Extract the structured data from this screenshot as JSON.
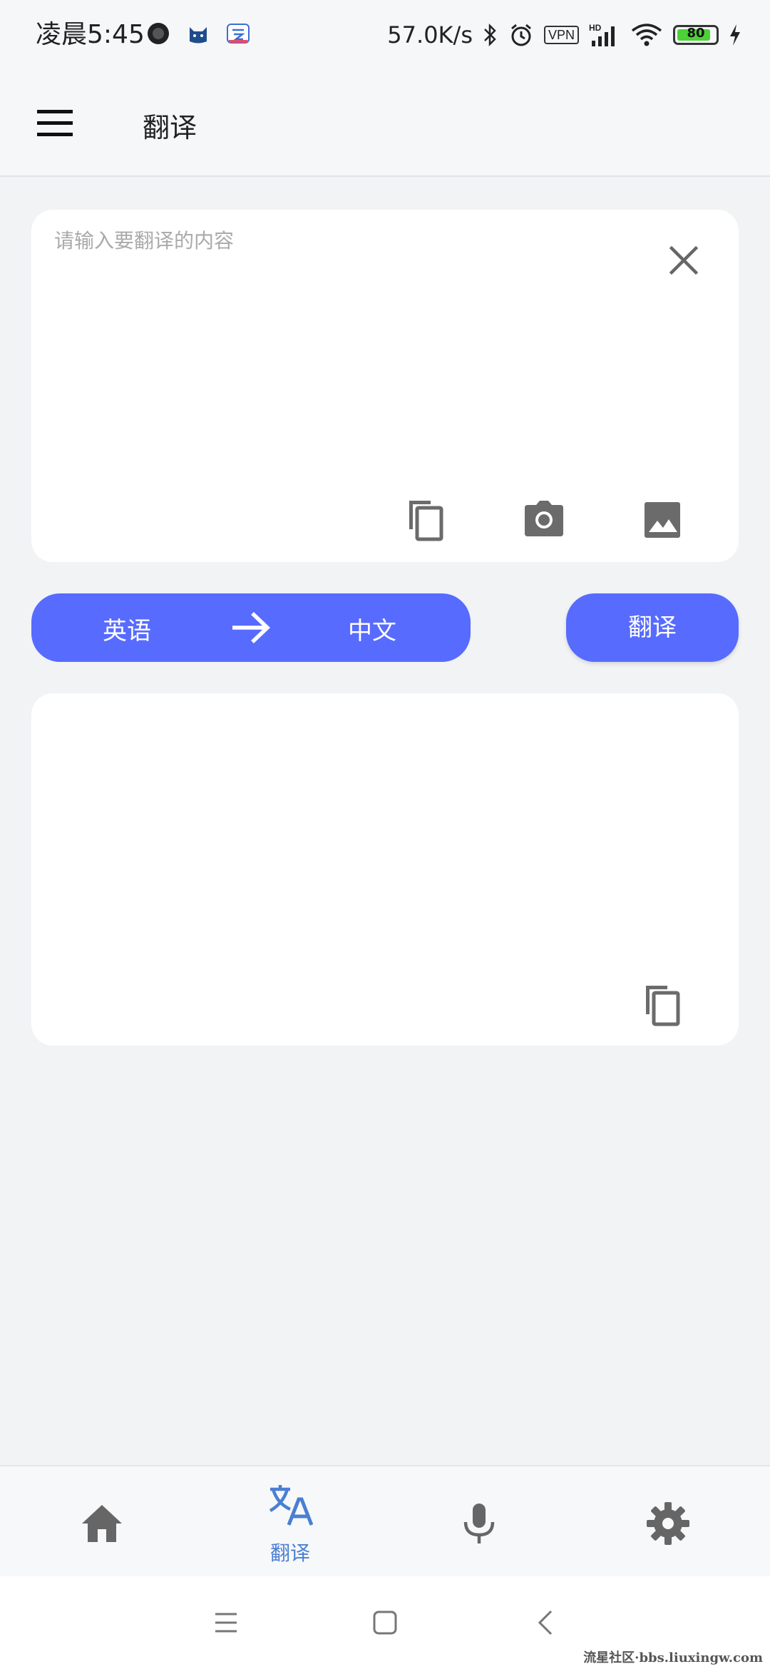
{
  "status_bar": {
    "time": "凌晨5:45",
    "net_speed": "57.0K/s",
    "vpn": "VPN",
    "hd": "HD",
    "battery": "80",
    "left_icons": [
      "dark-circle-app-icon",
      "cat-app-icon",
      "cloud-app-icon"
    ],
    "right_icons": [
      "bluetooth-icon",
      "alarm-icon",
      "vpn-icon",
      "signal-icon",
      "wifi-icon",
      "battery-icon",
      "charging-icon"
    ]
  },
  "app_bar": {
    "title": "翻译",
    "menu_icon": "hamburger-menu-icon"
  },
  "input_card": {
    "placeholder": "请输入要翻译的内容",
    "value": "",
    "icons": [
      "close-icon",
      "copy-icon",
      "camera-icon",
      "image-icon"
    ]
  },
  "language_bar": {
    "source": "英语",
    "target": "中文",
    "arrow_icon": "arrow-right-icon"
  },
  "translate_button": {
    "label": "翻译"
  },
  "output_card": {
    "text": "",
    "icons": [
      "copy-icon"
    ]
  },
  "bottom_nav": {
    "items": [
      {
        "icon": "home-icon",
        "label": "",
        "active": false
      },
      {
        "icon": "translate-icon",
        "label": "翻译",
        "active": true
      },
      {
        "icon": "microphone-icon",
        "label": "",
        "active": false
      },
      {
        "icon": "settings-gear-icon",
        "label": "",
        "active": false
      }
    ],
    "active_color": "#4a7fd4",
    "inactive_color": "#666666"
  },
  "system_nav": {
    "buttons": [
      "recents-menu-icon",
      "home-square-icon",
      "back-chevron-icon"
    ]
  },
  "watermark": "流星社区·bbs.liuxingw.com",
  "colors": {
    "accent": "#576bff",
    "background": "#f1f3f5",
    "card": "#ffffff",
    "icon_gray": "#6b6b6b"
  }
}
